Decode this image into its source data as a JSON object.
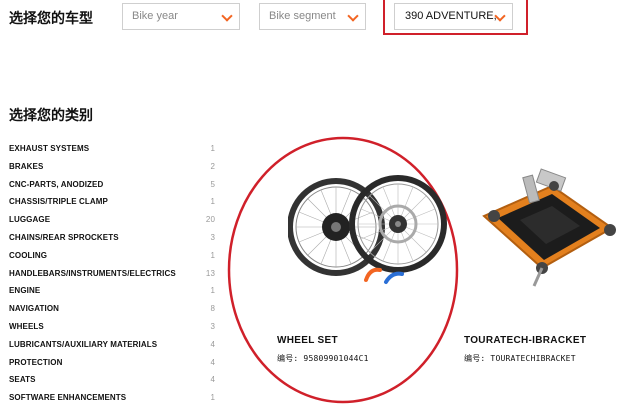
{
  "filter": {
    "heading": "选择您的车型",
    "year_placeholder": "Bike year",
    "segment_placeholder": "Bike segment",
    "model_value": "390 ADVENTURE, on"
  },
  "categories": {
    "heading": "选择您的类别",
    "items": [
      {
        "label": "EXHAUST SYSTEMS",
        "count": "1"
      },
      {
        "label": "BRAKES",
        "count": "2"
      },
      {
        "label": "CNC-PARTS, ANODIZED",
        "count": "5"
      },
      {
        "label": "CHASSIS/TRIPLE CLAMP",
        "count": "1"
      },
      {
        "label": "LUGGAGE",
        "count": "20"
      },
      {
        "label": "CHAINS/REAR SPROCKETS",
        "count": "3"
      },
      {
        "label": "COOLING",
        "count": "1"
      },
      {
        "label": "HANDLEBARS/INSTRUMENTS/ELECTRICS",
        "count": "13"
      },
      {
        "label": "ENGINE",
        "count": "1"
      },
      {
        "label": "NAVIGATION",
        "count": "8"
      },
      {
        "label": "WHEELS",
        "count": "3"
      },
      {
        "label": "LUBRICANTS/AUXILIARY MATERIALS",
        "count": "4"
      },
      {
        "label": "PROTECTION",
        "count": "4"
      },
      {
        "label": "SEATS",
        "count": "4"
      },
      {
        "label": "SOFTWARE ENHANCEMENTS",
        "count": "1"
      }
    ]
  },
  "products": [
    {
      "title": "WHEEL SET",
      "number": "编号: 95809901044C1"
    },
    {
      "title": "TOURATECH-IBRACKET",
      "number": "编号: TOURATECHIBRACKET"
    }
  ],
  "colors": {
    "accent": "#f26522",
    "highlight": "#d0202a"
  }
}
